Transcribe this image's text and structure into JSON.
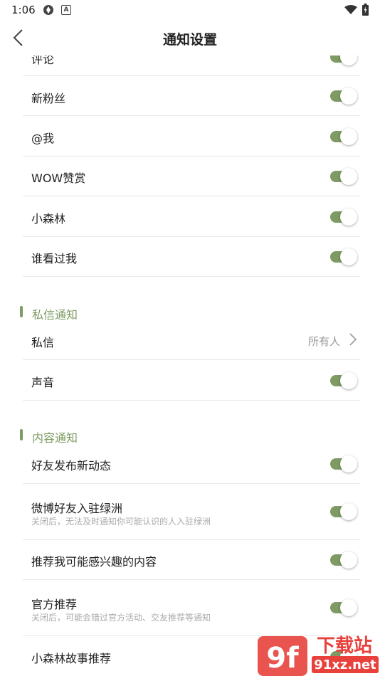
{
  "status_bar": {
    "time": "1:06",
    "notif_icon_letter": "A"
  },
  "header": {
    "title": "通知设置"
  },
  "rows_top": [
    {
      "label": "评论",
      "checked": true
    },
    {
      "label": "新粉丝",
      "checked": true
    },
    {
      "label": "@我",
      "checked": true
    },
    {
      "label": "WOW赞赏",
      "checked": true
    },
    {
      "label": "小森林",
      "checked": true
    },
    {
      "label": "谁看过我",
      "checked": true
    }
  ],
  "section_private": {
    "title": "私信通知",
    "message": {
      "label": "私信",
      "value": "所有人"
    },
    "sound": {
      "label": "声音",
      "checked": true
    }
  },
  "section_content": {
    "title": "内容通知",
    "rows": [
      {
        "label": "好友发布新动态",
        "checked": true
      },
      {
        "label": "微博好友入驻绿洲",
        "sub": "关闭后，无法及时通知你可能认识的人入驻绿洲",
        "checked": true
      },
      {
        "label": "推荐我可能感兴趣的内容",
        "checked": true
      },
      {
        "label": "官方推荐",
        "sub": "关闭后，可能会错过官方活动、交友推荐等通知",
        "checked": true
      },
      {
        "label": "小森林故事推荐",
        "checked": true
      }
    ]
  },
  "colors": {
    "accent": "#7d9b62",
    "watermark_red": "#e8413c"
  },
  "watermark": {
    "text_big": "下载站",
    "text_url": "91xz.net"
  }
}
